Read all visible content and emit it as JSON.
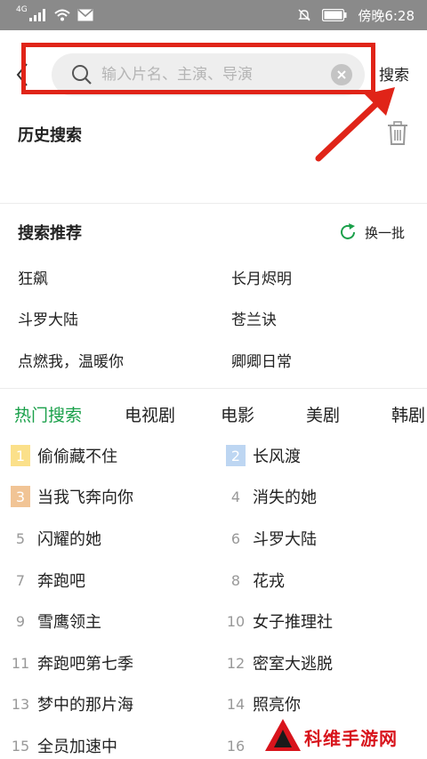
{
  "status_bar": {
    "network": "4G",
    "time": "傍晚6:28"
  },
  "search": {
    "placeholder": "输入片名、主演、导演",
    "value": "",
    "submit_label": "搜索"
  },
  "history": {
    "title": "历史搜索"
  },
  "recommend": {
    "title": "搜索推荐",
    "refresh_label": "换一批",
    "items": [
      "狂飙",
      "长月烬明",
      "斗罗大陆",
      "苍兰诀",
      "点燃我，温暖你",
      "卿卿日常"
    ]
  },
  "hot": {
    "tabs": [
      "热门搜索",
      "电视剧",
      "电影",
      "美剧",
      "韩剧"
    ],
    "active_tab": "热门搜索",
    "items": [
      {
        "rank": "1",
        "title": "偷偷藏不住"
      },
      {
        "rank": "2",
        "title": "长风渡"
      },
      {
        "rank": "3",
        "title": "当我飞奔向你"
      },
      {
        "rank": "4",
        "title": "消失的她"
      },
      {
        "rank": "5",
        "title": "闪耀的她"
      },
      {
        "rank": "6",
        "title": "斗罗大陆"
      },
      {
        "rank": "7",
        "title": "奔跑吧"
      },
      {
        "rank": "8",
        "title": "花戎"
      },
      {
        "rank": "9",
        "title": "雪鹰领主"
      },
      {
        "rank": "10",
        "title": "女子推理社"
      },
      {
        "rank": "11",
        "title": "奔跑吧第七季"
      },
      {
        "rank": "12",
        "title": "密室大逃脱"
      },
      {
        "rank": "13",
        "title": "梦中的那片海"
      },
      {
        "rank": "14",
        "title": "照亮你"
      },
      {
        "rank": "15",
        "title": "全员加速中"
      },
      {
        "rank": "16",
        "title": ""
      }
    ]
  },
  "watermark": {
    "text": "科维手游网"
  },
  "colors": {
    "accent_green": "#1aa04a",
    "highlight_red": "#e02418",
    "rank1": "#fbe08a",
    "rank2": "#bdd6f2",
    "rank3": "#f1c495"
  }
}
